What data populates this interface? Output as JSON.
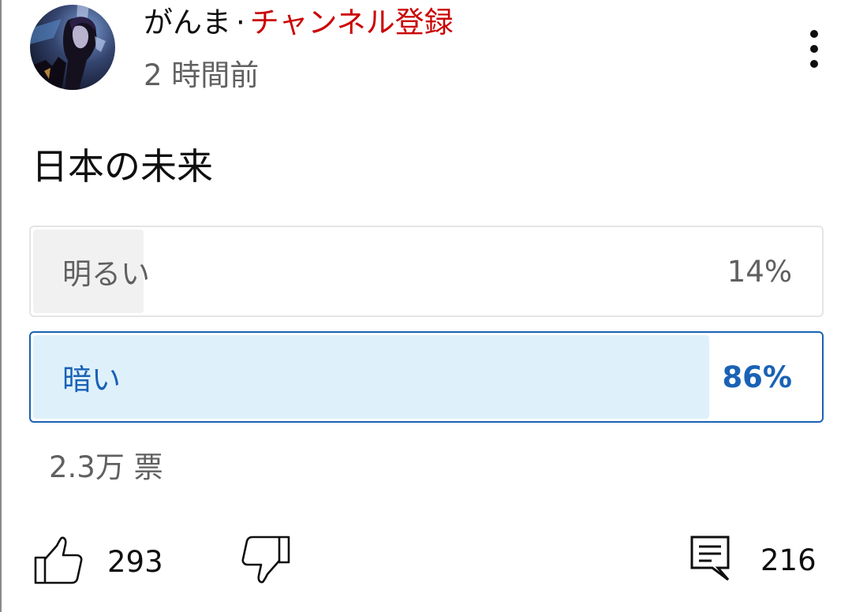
{
  "post": {
    "channel_name": "がんま",
    "separator": "·",
    "subscribe_label": "チャンネル登録",
    "time_ago": "2 時間前",
    "title": "日本の未来",
    "subscribe_color": "#cc0000",
    "accent_color": "#1a62b5"
  },
  "poll": {
    "options": [
      {
        "label": "明るい",
        "percent_text": "14%",
        "share": 0.14,
        "selected": false
      },
      {
        "label": "暗い",
        "percent_text": "86%",
        "share": 0.86,
        "selected": true
      }
    ],
    "vote_count": "2.3万 票"
  },
  "actions": {
    "likes": "293",
    "comments": "216",
    "like_icon": "thumb-up-icon",
    "dislike_icon": "thumb-down-icon",
    "comment_icon": "comment-icon",
    "more_icon": "more-vertical-icon"
  }
}
